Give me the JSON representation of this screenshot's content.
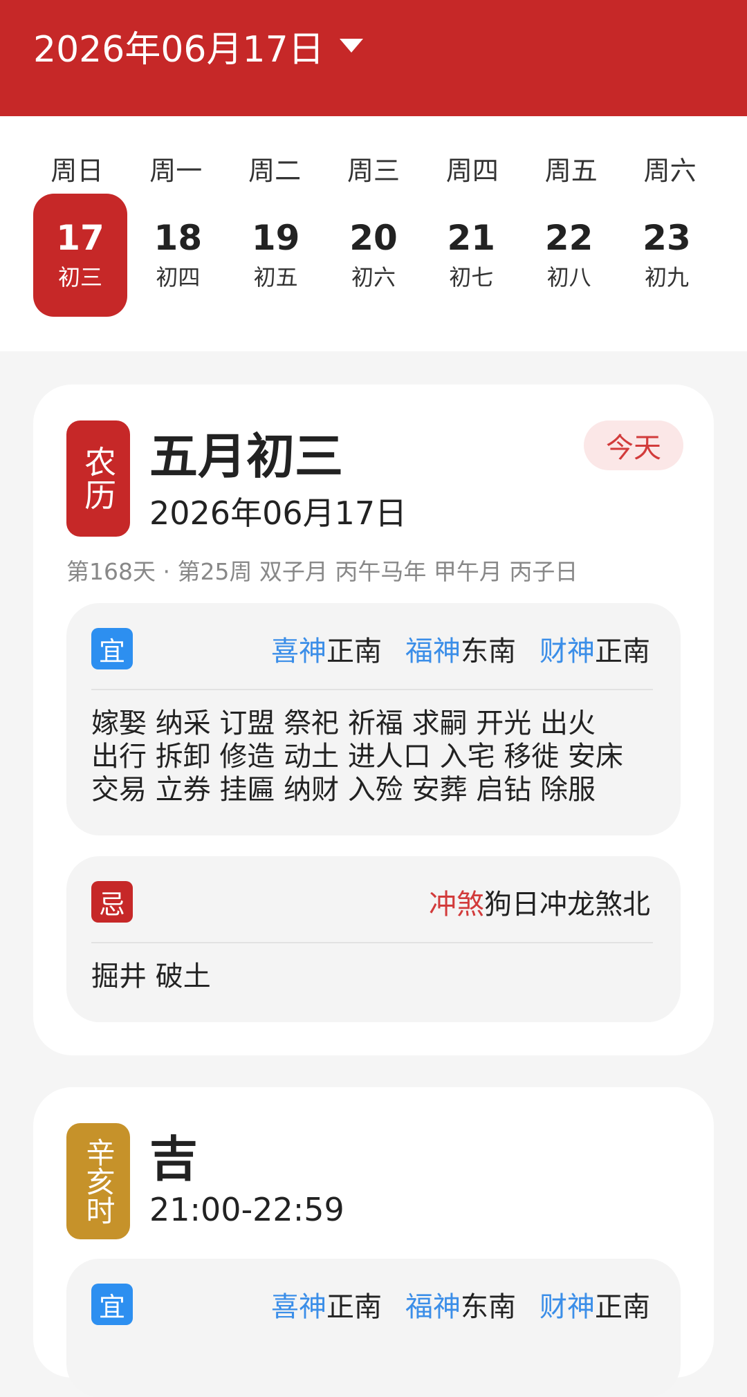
{
  "header": {
    "date_label": "2026年06月17日"
  },
  "week": {
    "weekdays": [
      "周日",
      "周一",
      "周二",
      "周三",
      "周四",
      "周五",
      "周六"
    ],
    "days": [
      {
        "num": "17",
        "lunar": "初三",
        "selected": true
      },
      {
        "num": "18",
        "lunar": "初四"
      },
      {
        "num": "19",
        "lunar": "初五"
      },
      {
        "num": "20",
        "lunar": "初六"
      },
      {
        "num": "21",
        "lunar": "初七"
      },
      {
        "num": "22",
        "lunar": "初八"
      },
      {
        "num": "23",
        "lunar": "初九"
      }
    ]
  },
  "day_card": {
    "badge": "农历",
    "title": "五月初三",
    "subtitle": "2026年06月17日",
    "today_label": "今天",
    "info_line": "第168天 · 第25周 双子月 丙午马年 甲午月 丙子日",
    "yi": {
      "tag": "宜",
      "gods": [
        {
          "name": "喜神",
          "dir": "正南"
        },
        {
          "name": "福神",
          "dir": "东南"
        },
        {
          "name": "财神",
          "dir": "正南"
        }
      ],
      "activity_lines": [
        "嫁娶 纳采 订盟 祭祀 祈福 求嗣 开光 出火",
        "出行 拆卸 修造 动土 进人口 入宅 移徙 安床",
        "交易 立券 挂匾 纳财 入殓 安葬 启钻 除服"
      ]
    },
    "ji": {
      "tag": "忌",
      "chongsha_label": "冲煞",
      "chongsha_text": "狗日冲龙煞北",
      "activity_lines": [
        "掘井 破土"
      ]
    }
  },
  "hour_card": {
    "badge": "辛亥时",
    "title": "吉",
    "subtitle": "21:00-22:59",
    "yi": {
      "tag": "宜",
      "gods": [
        {
          "name": "喜神",
          "dir": "正南"
        },
        {
          "name": "福神",
          "dir": "东南"
        },
        {
          "name": "财神",
          "dir": "正南"
        }
      ]
    }
  },
  "colors": {
    "primary_red": "#c62828",
    "accent_blue": "#2d8ff0",
    "hour_gold": "#c6922a"
  }
}
